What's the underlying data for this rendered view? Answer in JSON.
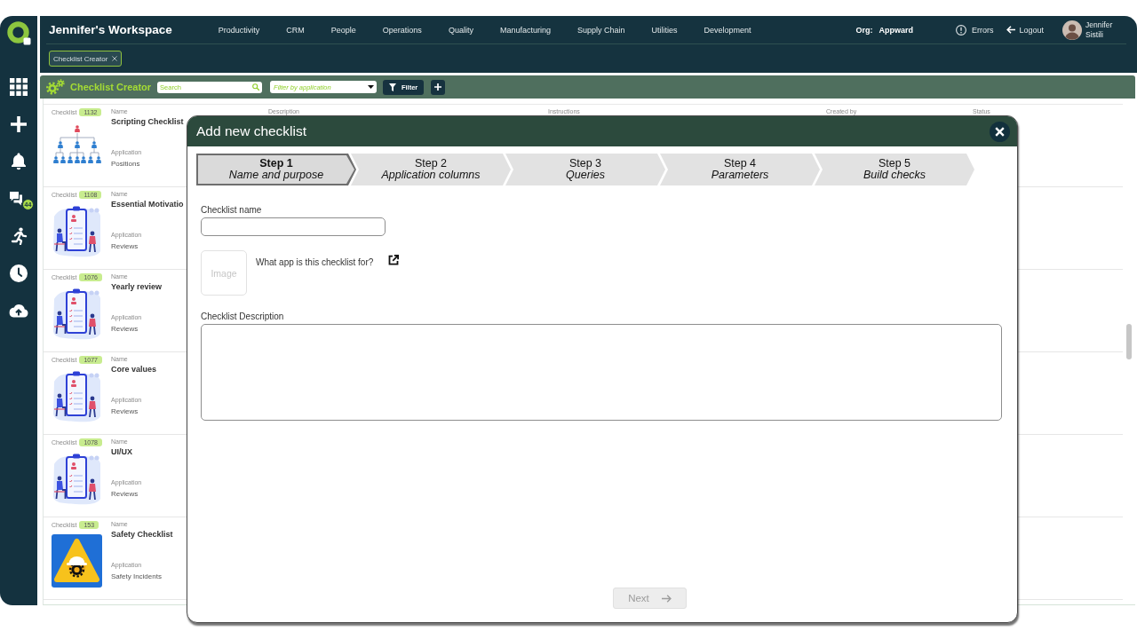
{
  "sidebar": {
    "message_badge": "44"
  },
  "header": {
    "title": "Jennifer's Workspace",
    "nav": [
      "Productivity",
      "CRM",
      "People",
      "Operations",
      "Quality",
      "Manufacturing",
      "Supply Chain",
      "Utilities",
      "Development"
    ],
    "org_label": "Org:",
    "org_name": "Appward",
    "errors": "Errors",
    "logout": "Logout",
    "user_name": "Jennifer Sistili",
    "tabs": [
      {
        "label": "Checklist Creator",
        "selected": true
      }
    ]
  },
  "toolbar": {
    "title": "Checklist Creator",
    "search": {
      "placeholder": "Search"
    },
    "application_filter": {
      "placeholder": "Filter by application"
    },
    "filter_button": "Filter"
  },
  "list": {
    "items": [
      {
        "kind": "org-chart",
        "id_label": "Checklist",
        "id": "1132",
        "name_label": "Name",
        "name": "Scripting Checklist",
        "application_label": "Application",
        "application": "Positions",
        "column_labels": [
          "Description",
          "Instructions",
          "Created by",
          "Status"
        ]
      },
      {
        "kind": "clipboard",
        "id_label": "Checklist",
        "id": "1108",
        "name_label": "Name",
        "name": "Essential Motivatio",
        "application_label": "Application",
        "application": "Reviews"
      },
      {
        "kind": "clipboard",
        "id_label": "Checklist",
        "id": "1076",
        "name_label": "Name",
        "name": "Yearly review",
        "application_label": "Application",
        "application": "Reviews"
      },
      {
        "kind": "clipboard",
        "id_label": "Checklist",
        "id": "1077",
        "name_label": "Name",
        "name": "Core values",
        "application_label": "Application",
        "application": "Reviews"
      },
      {
        "kind": "clipboard",
        "id_label": "Checklist",
        "id": "1078",
        "name_label": "Name",
        "name": "UI/UX",
        "application_label": "Application",
        "application": "Reviews"
      },
      {
        "kind": "safety-sign",
        "id_label": "Checklist",
        "id": "153",
        "name_label": "Name",
        "name": "Safety Checklist",
        "application_label": "Application",
        "application": "Safety Incidents"
      }
    ]
  },
  "modal": {
    "title": "Add new checklist",
    "steps": [
      {
        "title": "Step 1",
        "subtitle": "Name and purpose",
        "selected": true
      },
      {
        "title": "Step 2",
        "subtitle": "Application columns",
        "selected": false
      },
      {
        "title": "Step 3",
        "subtitle": "Queries",
        "selected": false
      },
      {
        "title": "Step 4",
        "subtitle": "Parameters",
        "selected": false
      },
      {
        "title": "Step 5",
        "subtitle": "Build checks",
        "selected": false
      }
    ],
    "name_label": "Checklist name",
    "image_picker": {
      "placeholder": "Image"
    },
    "app_question": "What app is this checklist for?",
    "description_label": "Checklist Description",
    "next_button": {
      "label": "Next",
      "disabled": true
    }
  }
}
